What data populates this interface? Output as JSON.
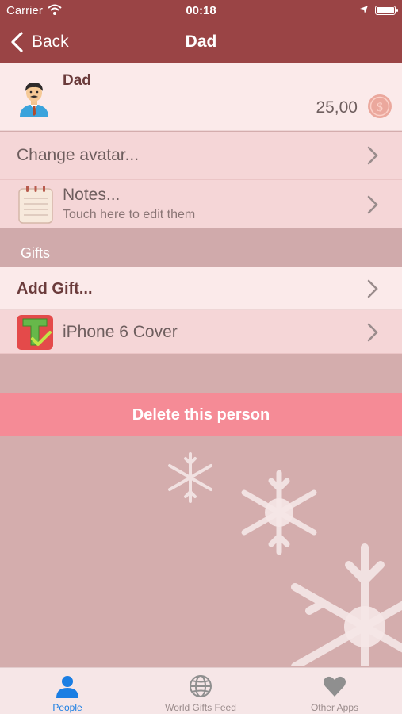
{
  "status_bar": {
    "carrier": "Carrier",
    "time": "00:18"
  },
  "nav": {
    "back_label": "Back",
    "title": "Dad"
  },
  "person": {
    "name": "Dad",
    "amount": "25,00"
  },
  "rows": {
    "change_avatar": "Change avatar...",
    "notes_title": "Notes...",
    "notes_subtitle": "Touch here to edit them"
  },
  "gifts_section": {
    "header": "Gifts",
    "add_gift": "Add Gift...",
    "items": [
      {
        "name": "iPhone 6 Cover"
      }
    ]
  },
  "delete_button": "Delete this person",
  "tabs": [
    {
      "label": "People",
      "icon": "person-icon",
      "active": true
    },
    {
      "label": "World Gifts Feed",
      "icon": "globe-icon",
      "active": false
    },
    {
      "label": "Other Apps",
      "icon": "heart-icon",
      "active": false
    }
  ],
  "colors": {
    "nav_bar": "#9a4445",
    "background": "#d4adad",
    "delete_button": "#f58b96",
    "active_tab": "#1b7ee3"
  }
}
